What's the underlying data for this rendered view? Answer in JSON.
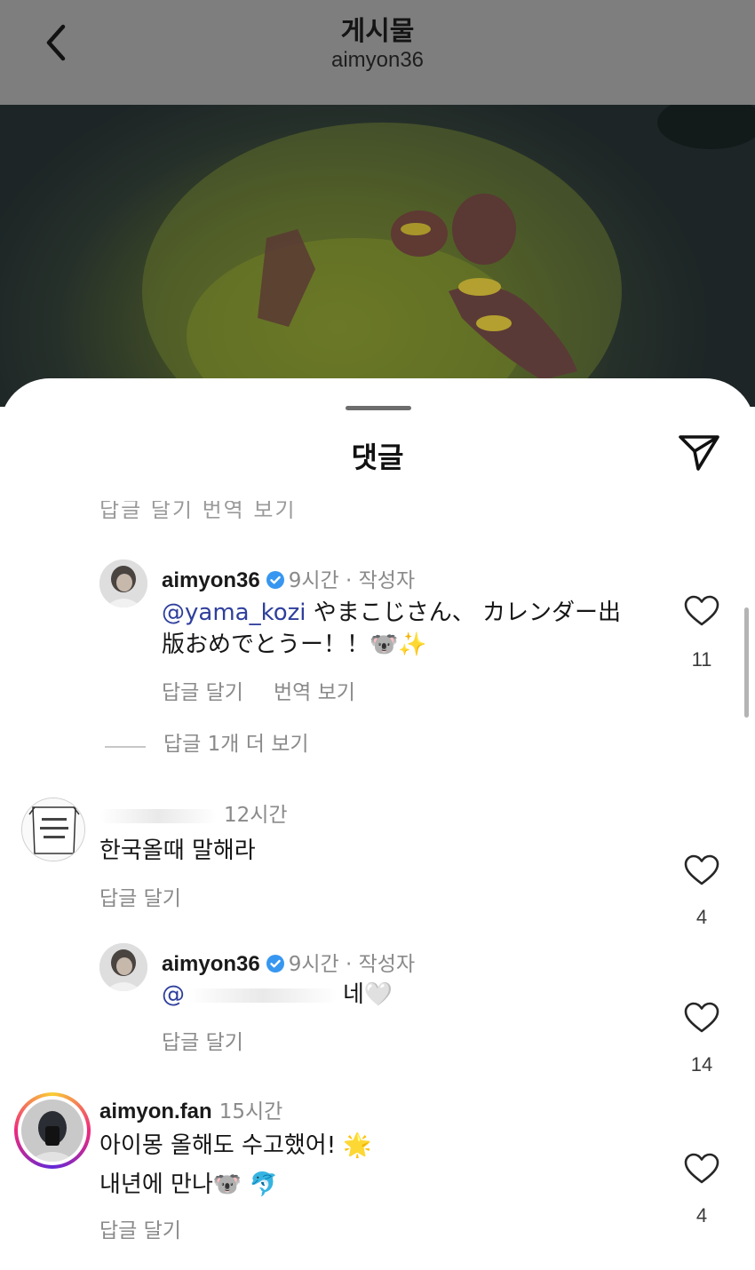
{
  "header": {
    "title": "게시물",
    "subtitle": "aimyon36"
  },
  "sheet": {
    "title": "댓글",
    "cut_text": "답글 달기   번역 보기"
  },
  "comments": [
    {
      "username": "aimyon36",
      "verified": true,
      "time": "9시간",
      "author_tag": " · 작성자",
      "mention": "@yama_kozi",
      "line1": " やまこじさん、 カレンダー出",
      "line2": "版おめでとうー！！🐨✨",
      "reply_label": "답글 달기",
      "translate_label": "번역 보기",
      "likes": "11",
      "more_replies": "답글 1개 더 보기"
    },
    {
      "username": "",
      "time": "12시간",
      "text": "한국올때 말해라",
      "reply_label": "답글 달기",
      "likes": "4"
    },
    {
      "username": "aimyon36",
      "verified": true,
      "time": "9시간",
      "author_tag": " · 작성자",
      "mention_prefix": "@",
      "text": "네🤍",
      "reply_label": "답글 달기",
      "likes": "14"
    },
    {
      "username": "aimyon.fan",
      "time": "15시간",
      "line1": "아이몽 올해도 수고했어! 🌟",
      "line2": "내년에 만나🐨 🐬",
      "reply_label": "답글 달기",
      "likes": "4"
    }
  ],
  "icons": {
    "back": "chevron-left-icon",
    "send": "paper-plane-icon",
    "like": "heart-outline-icon",
    "verified": "verified-badge-icon"
  },
  "colors": {
    "mention": "#2f3f9c",
    "verified": "#3797f0",
    "secondary_text": "#8a8a8a"
  }
}
